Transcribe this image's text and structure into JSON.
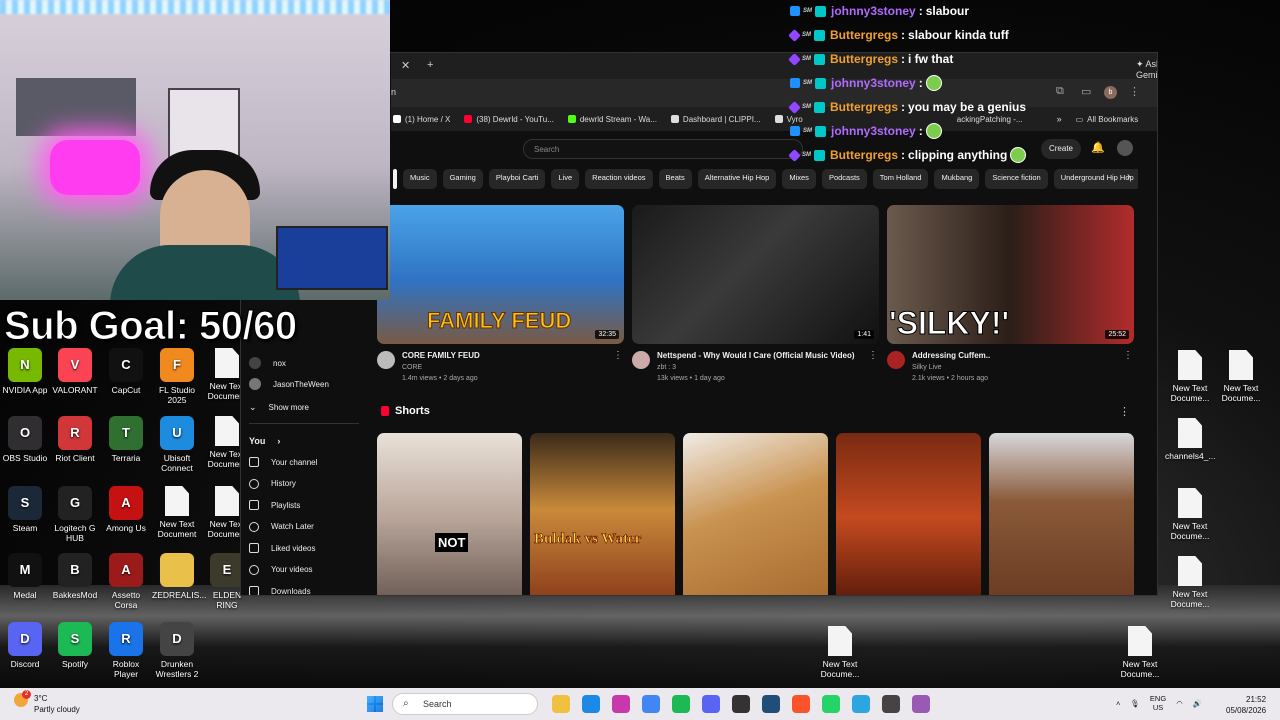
{
  "overlay": {
    "sub_goal": "Sub Goal: 50/60"
  },
  "chat": [
    {
      "user": "johnny3stoney",
      "text": "slabour",
      "color": "#b06cff",
      "badge": "b2"
    },
    {
      "user": "Buttergregs",
      "text": "slabour kinda tuff",
      "color": "#f0a030",
      "badge": "b1"
    },
    {
      "user": "Buttergregs",
      "text": "i fw that",
      "color": "#f0a030",
      "badge": "b1"
    },
    {
      "user": "johnny3stoney",
      "text": "",
      "color": "#b06cff",
      "badge": "b2"
    },
    {
      "user": "Buttergregs",
      "text": "you may be a genius",
      "color": "#f0a030",
      "badge": "b1"
    },
    {
      "user": "johnny3stoney",
      "text": "",
      "color": "#b06cff",
      "badge": "b2"
    },
    {
      "user": "Buttergregs",
      "text": "clipping anything",
      "color": "#f0a030",
      "badge": "b1"
    }
  ],
  "browser": {
    "ask_gemini": "Ask Gemini",
    "address_fragment": "n",
    "bookmarks": [
      {
        "label": "(1) Home / X",
        "color": "#ffffff"
      },
      {
        "label": "(38) Dewrld - YouTu...",
        "color": "#ff0033"
      },
      {
        "label": "dewrld Stream - Wa...",
        "color": "#53fc18"
      },
      {
        "label": "Dashboard | CLIPPI...",
        "color": "#dddddd"
      },
      {
        "label": "Vyro",
        "color": "#dddddd"
      }
    ],
    "bookmark_partial": "ackingPatching -...",
    "all_bookmarks": "All Bookmarks"
  },
  "youtube": {
    "search_placeholder": "Search",
    "create_label": "Create",
    "chips": [
      "Music",
      "Gaming",
      "Playboi Carti",
      "Live",
      "Reaction videos",
      "Beats",
      "Alternative Hip Hop",
      "Mixes",
      "Podcasts",
      "Tom Holland",
      "Mukbang",
      "Science fiction",
      "Underground Hip Hop"
    ],
    "subscriptions": [
      "nox",
      "JasonTheWeen"
    ],
    "show_more": "Show more",
    "you_label": "You",
    "you_items": [
      "Your channel",
      "History",
      "Playlists",
      "Watch Later",
      "Liked videos",
      "Your videos",
      "Downloads"
    ],
    "videos": [
      {
        "title": "CORE FAMILY FEUD",
        "channel": "CORE",
        "meta": "1.4m views • 2 days ago",
        "duration": "32:35",
        "overlay": "FAMILY FEUD"
      },
      {
        "title": "Nettspend - Why Would I Care (Official Music Video)",
        "channel": "zbt : 3",
        "meta": "13k views • 1 day ago",
        "duration": "1:41",
        "overlay": ""
      },
      {
        "title": "Addressing Cuffem..",
        "channel": "Silky Live",
        "meta": "2.1k views • 2 hours ago",
        "duration": "25:52",
        "overlay": "'SILKY!'"
      }
    ],
    "shorts_label": "Shorts",
    "shorts": [
      {
        "overlay": "NOT"
      },
      {
        "overlay": "Buldak vs Water"
      },
      {
        "overlay": ""
      },
      {
        "overlay": ""
      },
      {
        "overlay": ""
      }
    ]
  },
  "desktop_icons": [
    {
      "label": "NVIDIA App",
      "color": "#76b900",
      "glyph": "N"
    },
    {
      "label": "VALORANT",
      "color": "#fa4454",
      "glyph": "V"
    },
    {
      "label": "CapCut",
      "color": "#111111",
      "glyph": "C"
    },
    {
      "label": "FL Studio 2025",
      "color": "#f08a1e",
      "glyph": "F"
    },
    {
      "label": "New Text Document",
      "color": "file",
      "glyph": ""
    },
    {
      "label": "OBS Studio",
      "color": "#302e31",
      "glyph": "O"
    },
    {
      "label": "Riot Client",
      "color": "#d13639",
      "glyph": "R"
    },
    {
      "label": "Terraria",
      "color": "#2f6f2f",
      "glyph": "T"
    },
    {
      "label": "Ubisoft Connect",
      "color": "#1d8bde",
      "glyph": "U"
    },
    {
      "label": "New Text Document",
      "color": "file",
      "glyph": ""
    },
    {
      "label": "Steam",
      "color": "#1b2838",
      "glyph": "S"
    },
    {
      "label": "Logitech G HUB",
      "color": "#222222",
      "glyph": "G"
    },
    {
      "label": "Among Us",
      "color": "#c51111",
      "glyph": "A"
    },
    {
      "label": "New Text Document",
      "color": "file",
      "glyph": ""
    },
    {
      "label": "New Text Document",
      "color": "file",
      "glyph": ""
    },
    {
      "label": "Medal",
      "color": "#111111",
      "glyph": "M"
    },
    {
      "label": "BakkesMod",
      "color": "#222222",
      "glyph": "B"
    },
    {
      "label": "Assetto Corsa",
      "color": "#9b1b1b",
      "glyph": "A"
    },
    {
      "label": "ZEDREALIS...",
      "color": "#e8c04a",
      "glyph": ""
    },
    {
      "label": "ELDEN RING",
      "color": "#3c3a2a",
      "glyph": "E"
    },
    {
      "label": "Discord",
      "color": "#5865f2",
      "glyph": "D"
    },
    {
      "label": "Spotify",
      "color": "#1db954",
      "glyph": "S"
    },
    {
      "label": "Roblox Player",
      "color": "#1a73e8",
      "glyph": "R"
    },
    {
      "label": "Drunken Wrestlers 2",
      "color": "#444444",
      "glyph": "D"
    }
  ],
  "right_desktop_icons": [
    "New Text Docume...",
    "New Text Docume...",
    "channels4_...",
    "New Text Docume...",
    "New Text Docume...",
    "New Text Docume...",
    "New Text Docume..."
  ],
  "taskbar": {
    "temperature": "3°C",
    "condition": "Partly cloudy",
    "weather_badge": "2",
    "search_placeholder": "Search",
    "lang": "ENG",
    "region": "US",
    "time": "21:52",
    "date": "05/08/2026",
    "app_colors": [
      "#f0c040",
      "#1e88e5",
      "#c837ab",
      "#4285f4",
      "#1db954",
      "#5865f2",
      "#333333",
      "#1f4e79",
      "#fb542b",
      "#25d366",
      "#2ca5e0",
      "#444444",
      "#9b59b6"
    ]
  }
}
